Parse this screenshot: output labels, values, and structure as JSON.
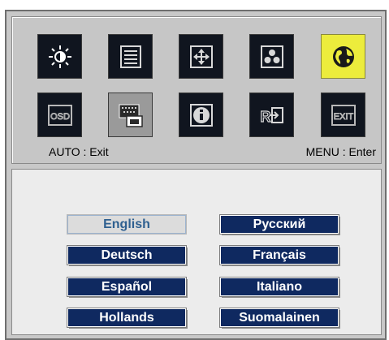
{
  "hints": {
    "auto": "AUTO : Exit",
    "menu": "MENU : Enter"
  },
  "menu_icons": [
    {
      "name": "brightness-icon",
      "active": false
    },
    {
      "name": "picture-list-icon",
      "active": false
    },
    {
      "name": "position-icon",
      "active": false
    },
    {
      "name": "color-icon",
      "active": false
    },
    {
      "name": "language-globe-icon",
      "active": true
    },
    {
      "name": "osd-icon",
      "active": false
    },
    {
      "name": "input-source-icon",
      "active": false
    },
    {
      "name": "information-icon",
      "active": false
    },
    {
      "name": "reset-icon",
      "active": false
    },
    {
      "name": "exit-icon",
      "active": false
    }
  ],
  "languages": {
    "english": "English",
    "russian": "Русский",
    "deutsch": "Deutsch",
    "francais": "Français",
    "espanol": "Español",
    "italiano": "Italiano",
    "hollands": "Hollands",
    "suomalainen": "Suomalainen",
    "selected": "English"
  },
  "colors": {
    "active_icon": "#ecec3c",
    "button_bg": "#0f2960",
    "selected_text": "#2f6090"
  }
}
